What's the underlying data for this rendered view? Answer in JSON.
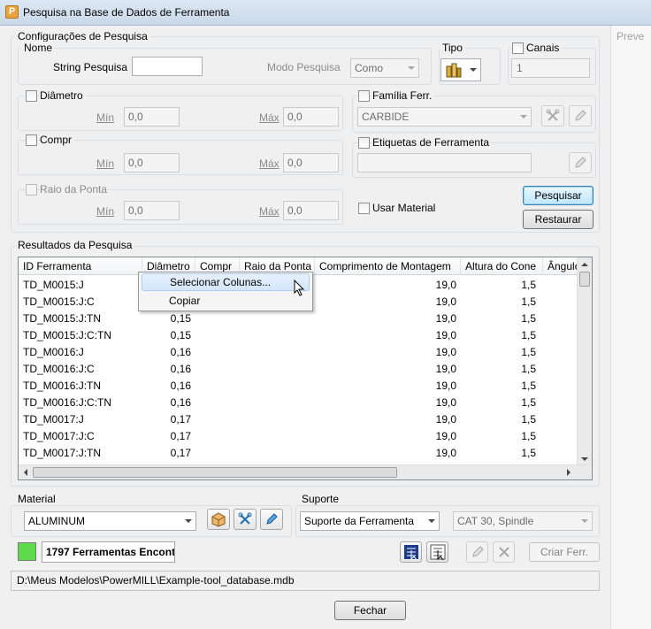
{
  "window": {
    "title": "Pesquisa na Base de Dados de Ferramenta",
    "side_label": "Preve"
  },
  "config": {
    "group_label": "Configurações de Pesquisa",
    "nome_label": "Nome",
    "string_label": "String Pesquisa",
    "string_value": "",
    "modo_label": "Modo Pesquisa",
    "modo_value": "Como",
    "tipo_label": "Tipo",
    "canais_label": "Canais",
    "canais_value": "1",
    "diametro_label": "Diâmetro",
    "compr_label": "Compr",
    "raio_label": "Raio da Ponta",
    "min_label": "Mín",
    "max_label": "Máx",
    "diametro_min": "0,0",
    "diametro_max": "0,0",
    "compr_min": "0,0",
    "compr_max": "0,0",
    "raio_min": "0,0",
    "raio_max": "0,0",
    "familia_label": "Família Ferr.",
    "familia_value": "CARBIDE",
    "etiquetas_label": "Etiquetas de Ferramenta",
    "etiquetas_value": "",
    "usar_material_label": "Usar Material",
    "pesquisar_label": "Pesquisar",
    "restaurar_label": "Restaurar"
  },
  "results": {
    "group_label": "Resultados da Pesquisa",
    "columns": [
      "ID Ferramenta",
      "Diâmetro",
      "Compr",
      "Raio da Ponta",
      "Comprimento de Montagem",
      "Altura do Cone",
      "Ângulo"
    ],
    "rows": [
      {
        "id": "TD_M0015:J",
        "diam": "",
        "mont": "19,0",
        "cone": "1,5"
      },
      {
        "id": "TD_M0015:J:C",
        "diam": "",
        "mont": "19,0",
        "cone": "1,5"
      },
      {
        "id": "TD_M0015:J:TN",
        "diam": "0,15",
        "mont": "19,0",
        "cone": "1,5"
      },
      {
        "id": "TD_M0015:J:C:TN",
        "diam": "0,15",
        "mont": "19,0",
        "cone": "1,5"
      },
      {
        "id": "TD_M0016:J",
        "diam": "0,16",
        "mont": "19,0",
        "cone": "1,5"
      },
      {
        "id": "TD_M0016:J:C",
        "diam": "0,16",
        "mont": "19,0",
        "cone": "1,5"
      },
      {
        "id": "TD_M0016:J:TN",
        "diam": "0,16",
        "mont": "19,0",
        "cone": "1,5"
      },
      {
        "id": "TD_M0016:J:C:TN",
        "diam": "0,16",
        "mont": "19,0",
        "cone": "1,5"
      },
      {
        "id": "TD_M0017:J",
        "diam": "0,17",
        "mont": "19,0",
        "cone": "1,5"
      },
      {
        "id": "TD_M0017:J:C",
        "diam": "0,17",
        "mont": "19,0",
        "cone": "1,5"
      },
      {
        "id": "TD_M0017:J:TN",
        "diam": "0,17",
        "mont": "19,0",
        "cone": "1,5"
      }
    ],
    "context_menu": [
      "Selecionar Colunas...",
      "Copiar"
    ]
  },
  "material": {
    "group_label": "Material",
    "value": "ALUMINUM"
  },
  "suporte": {
    "group_label": "Suporte",
    "value": "Suporte da Ferramenta",
    "spindle_value": "CAT 30, Spindle"
  },
  "footer": {
    "count_text": "1797 Ferramentas Encontr",
    "status_color": "#5ddb4a",
    "criar_label": "Criar Ferr.",
    "path": "D:\\Meus Modelos\\PowerMILL\\Example-tool_database.mdb",
    "fechar_label": "Fechar"
  }
}
